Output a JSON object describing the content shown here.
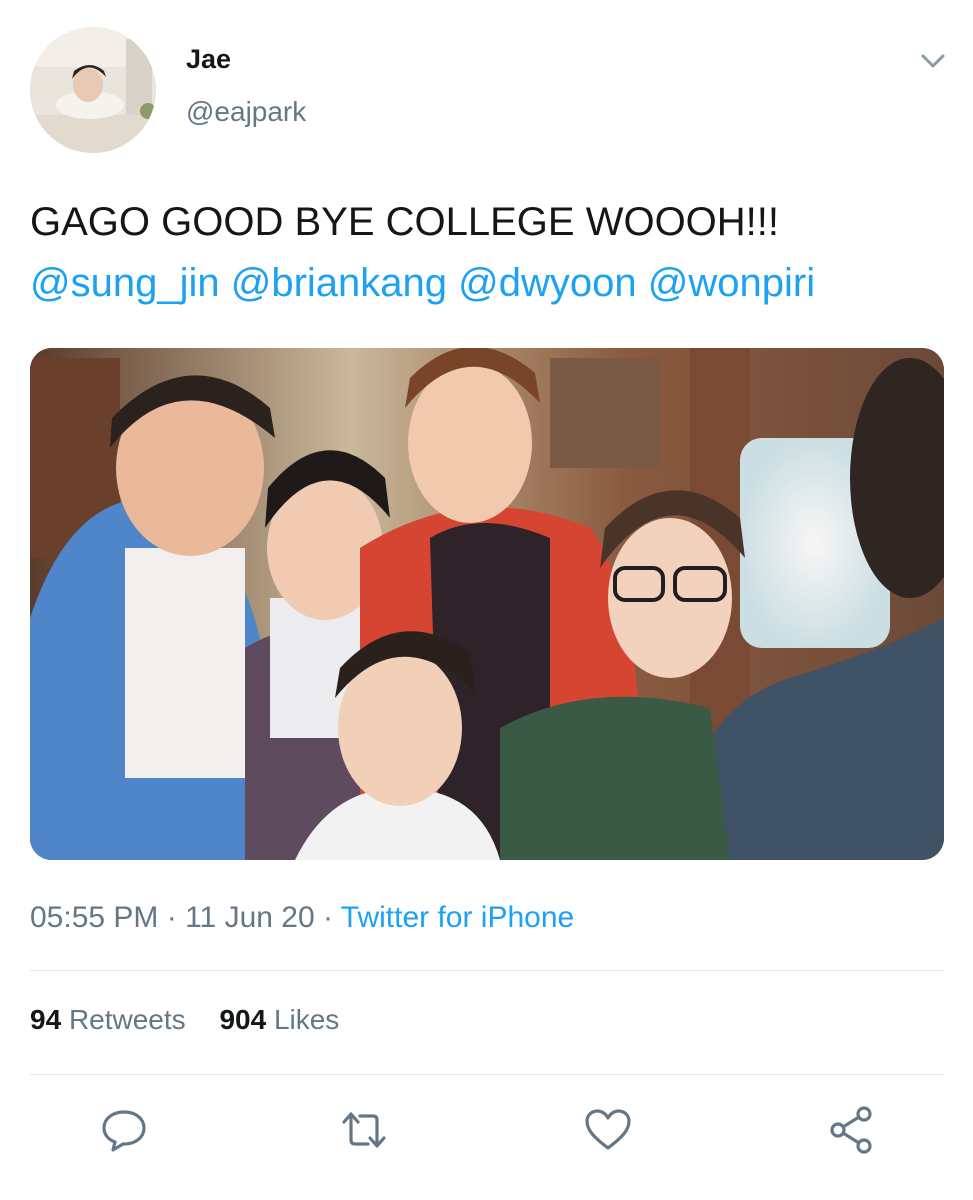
{
  "user": {
    "display_name": "Jae",
    "handle": "@eajpark"
  },
  "tweet": {
    "text": "GAGO GOOD BYE COLLEGE WOOOH!!!",
    "mentions": [
      "@sung_jin",
      "@briankang",
      "@dwyoon",
      "@wonpiri"
    ],
    "time": "05:55 PM",
    "separator": " · ",
    "date": "11 Jun 20",
    "source": "Twitter for iPhone"
  },
  "stats": {
    "retweets_count": "94",
    "retweets_label": "Retweets",
    "likes_count": "904",
    "likes_label": "Likes"
  },
  "icons": {
    "caret": "chevron-down-icon",
    "reply": "reply-icon",
    "retweet": "retweet-icon",
    "like": "heart-icon",
    "share": "share-icon"
  },
  "colors": {
    "link": "#1da1f2",
    "secondary_text": "#657786",
    "divider": "#e1e8ed",
    "icon": "#657786"
  }
}
